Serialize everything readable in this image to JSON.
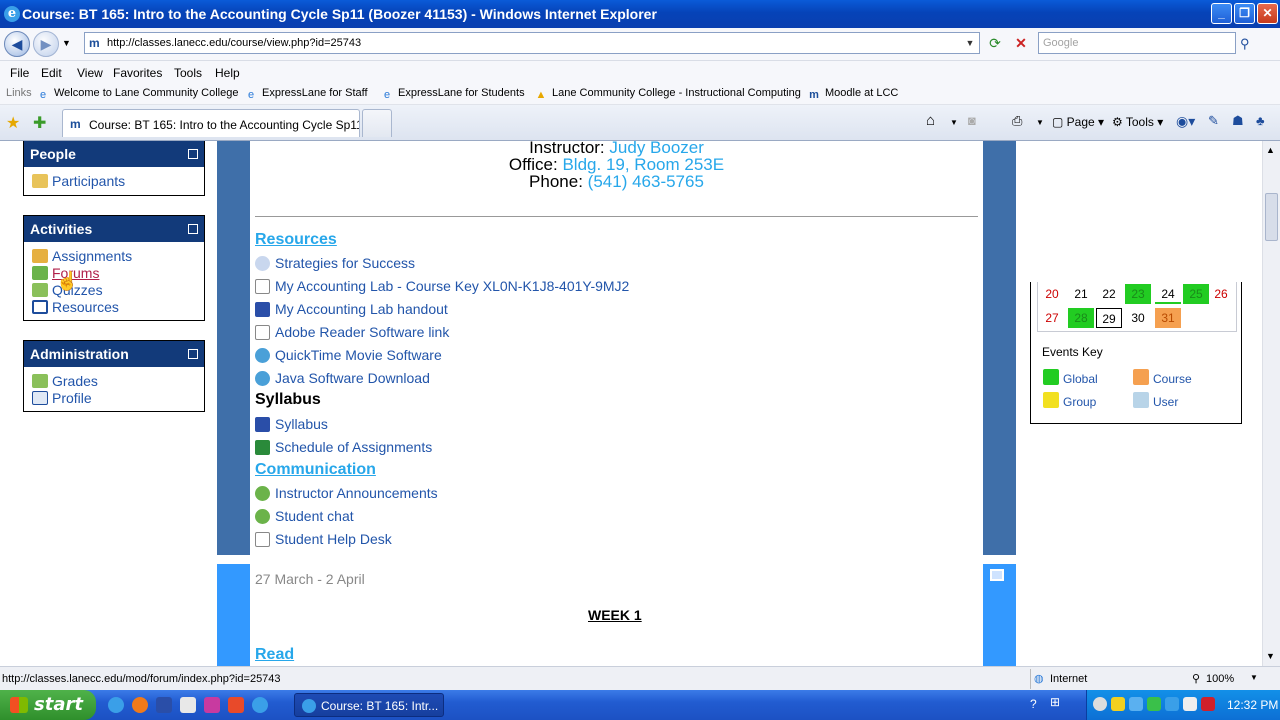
{
  "window": {
    "title": "Course: BT 165: Intro to the Accounting Cycle Sp11 (Boozer 41153) - Windows Internet Explorer"
  },
  "address": {
    "url": "http://classes.lanecc.edu/course/view.php?id=25743",
    "search_placeholder": "Google"
  },
  "menu": [
    "File",
    "Edit",
    "View",
    "Favorites",
    "Tools",
    "Help"
  ],
  "links": {
    "label": "Links",
    "items": [
      "Welcome to Lane Community College",
      "ExpressLane for Staff",
      "ExpressLane for Students",
      "Lane Community College - Instructional Computing",
      "Moodle at LCC"
    ]
  },
  "tab": {
    "title": "Course: BT 165: Intro to the Accounting Cycle Sp11 (..."
  },
  "commands": {
    "page": "Page",
    "tools": "Tools"
  },
  "blocks": {
    "people": {
      "title": "People",
      "items": [
        "Participants"
      ]
    },
    "activities": {
      "title": "Activities",
      "items": [
        "Assignments",
        "Forums",
        "Quizzes",
        "Resources"
      ]
    },
    "administration": {
      "title": "Administration",
      "items": [
        "Grades",
        "Profile"
      ]
    }
  },
  "course": {
    "instructor_label": "Instructor:",
    "instructor": "Judy Boozer",
    "office_label": "Office:",
    "office": "Bldg. 19, Room 253E",
    "phone_label": "Phone:",
    "phone": "(541) 463-5765",
    "resources_heading": "Resources",
    "resources": [
      "Strategies for Success",
      "My Accounting Lab - Course Key XL0N-K1J8-401Y-9MJ2",
      "My Accounting Lab handout",
      "Adobe Reader Software link",
      "QuickTime Movie Software",
      "Java Software Download"
    ],
    "syllabus_heading": "Syllabus",
    "syllabus": [
      "Syllabus",
      "Schedule of Assignments"
    ],
    "communication_heading": "Communication",
    "communication": [
      "Instructor Announcements",
      "Student chat",
      "Student Help Desk"
    ],
    "week_dates": "27 March - 2 April",
    "week_title": "WEEK 1",
    "read_heading": "Read"
  },
  "calendar": {
    "row1": [
      "20",
      "21",
      "22",
      "23",
      "24",
      "25",
      "26"
    ],
    "row2": [
      "27",
      "28",
      "29",
      "30",
      "31"
    ],
    "events_key": "Events Key",
    "keys": [
      "Global",
      "Course",
      "Group",
      "User"
    ]
  },
  "status": {
    "url": "http://classes.lanecc.edu/mod/forum/index.php?id=25743",
    "zone": "Internet",
    "zoom": "100%"
  },
  "taskbar": {
    "start": "start",
    "item": "Course: BT 165: Intr...",
    "clock": "12:32 PM"
  }
}
